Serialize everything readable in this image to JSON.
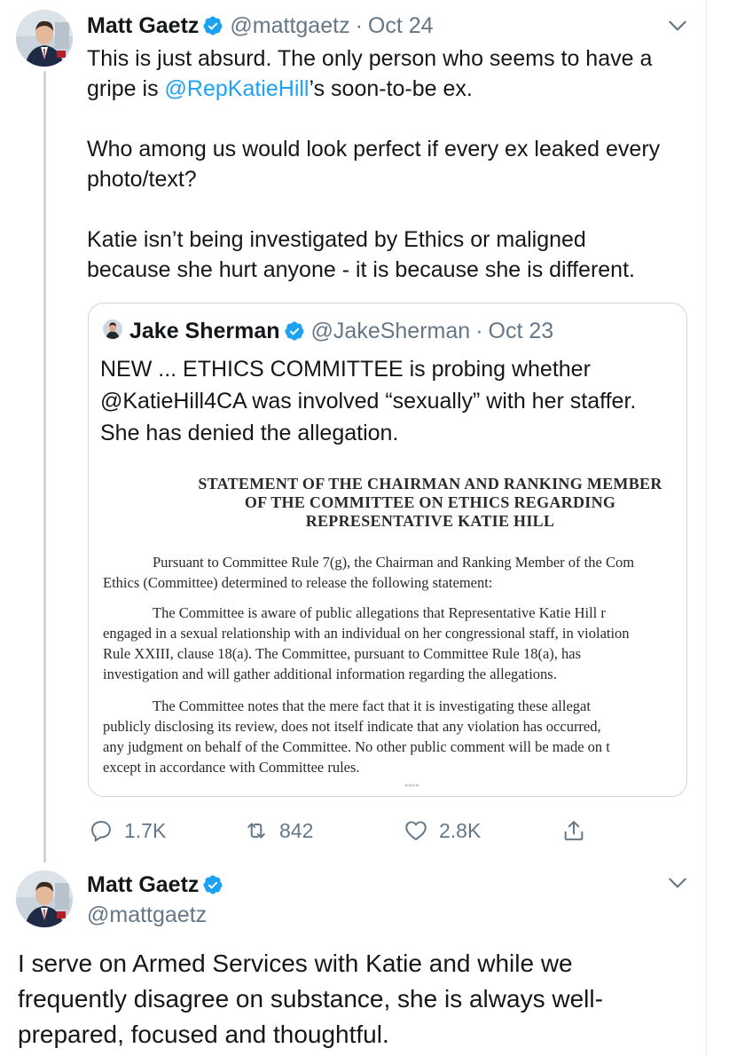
{
  "tweet1": {
    "display_name": "Matt Gaetz",
    "handle": "@mattgaetz",
    "separator": "·",
    "date": "Oct 24",
    "text_l1": "This is just absurd. The only person who seems to have a",
    "text_l2_pre": "gripe is ",
    "text_l2_mention": "@RepKatieHill",
    "text_l2_post": "’s soon-to-be ex.",
    "text_p2_l1": "Who among us would look perfect if every ex leaked every",
    "text_p2_l2": "photo/text?",
    "text_p3_l1": "Katie isn’t being investigated by Ethics or maligned",
    "text_p3_l2": "because she hurt anyone - it is because she is different.",
    "actions": {
      "replies": "1.7K",
      "retweets": "842",
      "likes": "2.8K"
    }
  },
  "quote": {
    "display_name": "Jake Sherman",
    "handle": "@JakeSherman",
    "separator": "·",
    "date": "Oct 23",
    "text_l1": "NEW ... ETHICS COMMITTEE is probing whether",
    "text_l2": "@KatieHill4CA was involved “sexually” with her staffer.",
    "text_l3": "She has denied the allegation."
  },
  "document": {
    "title_l1": "STATEMENT OF THE CHAIRMAN AND RANKING MEMBER",
    "title_l2": "OF THE COMMITTEE ON ETHICS REGARDING",
    "title_l3": "REPRESENTATIVE KATIE HILL",
    "p1_l1": "Pursuant to Committee Rule 7(g), the Chairman and Ranking Member of the Com",
    "p1_l2": "Ethics (Committee) determined to release the following statement:",
    "p2_l1": "The Committee is aware of public allegations that Representative Katie Hill r",
    "p2_l2": "engaged in a sexual relationship with an individual on her congressional staff, in violation",
    "p2_l3": "Rule XXIII, clause 18(a).  The Committee, pursuant to Committee Rule 18(a), has",
    "p2_l4": "investigation and will gather additional information regarding the allegations.",
    "p3_l1": "The Committee notes that the mere fact that it is investigating these allegat",
    "p3_l2": "publicly disclosing its review, does not itself indicate that any violation has occurred,",
    "p3_l3": "any judgment on behalf of the Committee.  No other public comment will be made on t",
    "p3_l4": "except in accordance with Committee rules.",
    "trailing": "\"\"\"\""
  },
  "tweet2": {
    "display_name": "Matt Gaetz",
    "handle": "@mattgaetz",
    "text_l1": "I serve on Armed Services with Katie and while we",
    "text_l2": "frequently disagree on substance, she is always well-",
    "text_l3": "prepared, focused and thoughtful."
  },
  "icons": {
    "verified": "verified-badge-icon",
    "chevron": "chevron-down-icon",
    "reply": "reply-icon",
    "retweet": "retweet-icon",
    "like": "like-icon",
    "share": "share-icon"
  },
  "colors": {
    "accent": "#1da1f2",
    "secondary_text": "#657786",
    "border": "#ccd6dd"
  }
}
